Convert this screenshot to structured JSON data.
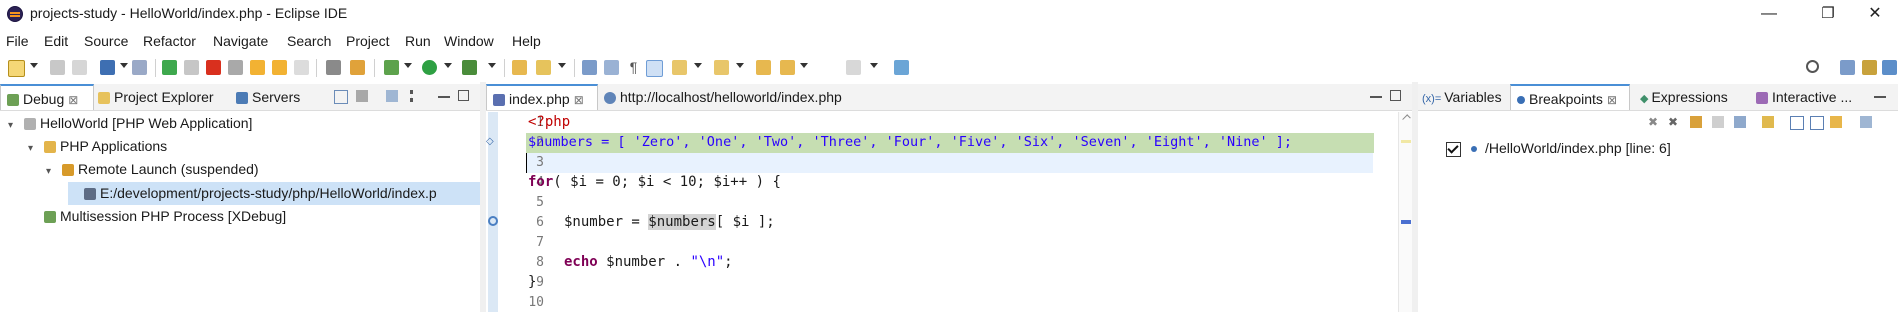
{
  "window": {
    "title": "projects-study - HelloWorld/index.php - Eclipse IDE",
    "buttons": [
      "—",
      "❐",
      "✕"
    ]
  },
  "menu": {
    "items": [
      "File",
      "Edit",
      "Source",
      "Refactor",
      "Navigate",
      "Search",
      "Project",
      "Run",
      "Window",
      "Help"
    ]
  },
  "left_panel": {
    "tabs": [
      {
        "label": "Debug",
        "close": "⊠"
      },
      {
        "label": "Project Explorer",
        "close": ""
      },
      {
        "label": "Servers",
        "close": ""
      }
    ],
    "tree": [
      {
        "twisty": "▾",
        "label": "HelloWorld [PHP Web Application]"
      },
      {
        "twisty": "▾",
        "label": "PHP Applications"
      },
      {
        "twisty": "▾",
        "label": "Remote Launch (suspended)"
      },
      {
        "twisty": "",
        "label": "E:/development/projects-study/php/HelloWorld/index.p"
      },
      {
        "twisty": "",
        "label": "Multisession PHP Process [XDebug]"
      }
    ]
  },
  "editor": {
    "tabs": [
      {
        "label": "index.php",
        "close": "⊠"
      },
      {
        "label": "http://localhost/helloworld/index.php",
        "close": ""
      }
    ],
    "line_numbers": [
      "1",
      "2",
      "3",
      "4",
      "5",
      "6",
      "7",
      "8",
      "9",
      "10"
    ],
    "code": {
      "l1": "<?php",
      "l2": "$numbers = [ 'Zero', 'One', 'Two', 'Three', 'Four', 'Five', 'Six', 'Seven', 'Eight', 'Nine' ];",
      "l4_kw": "for",
      "l4": "( $i = 0; $i < 10; $i++ ) {",
      "l6_a": "$number = ",
      "l6_b": "$numbers",
      "l6_c": "[ $i ];",
      "l8_kw": "echo",
      "l8_a": " $number . ",
      "l8_str": "\"\\n\"",
      "l8_b": ";",
      "l9": "}"
    }
  },
  "right_panel": {
    "tabs": [
      {
        "label": "Variables",
        "prefix": "(x)="
      },
      {
        "label": "Breakpoints",
        "close": "⊠"
      },
      {
        "label": "Expressions",
        "prefix": "◆"
      },
      {
        "label": "Interactive ...",
        "prefix": ""
      }
    ],
    "breakpoint": {
      "label": "/HelloWorld/index.php [line: 6]",
      "checked": true
    }
  },
  "colors": {
    "highlight_line": "#c6deb2",
    "current_line": "#e8f2fe",
    "keyword": "#7f0055",
    "string": "#2a00ff",
    "php_tag": "#c00000"
  }
}
